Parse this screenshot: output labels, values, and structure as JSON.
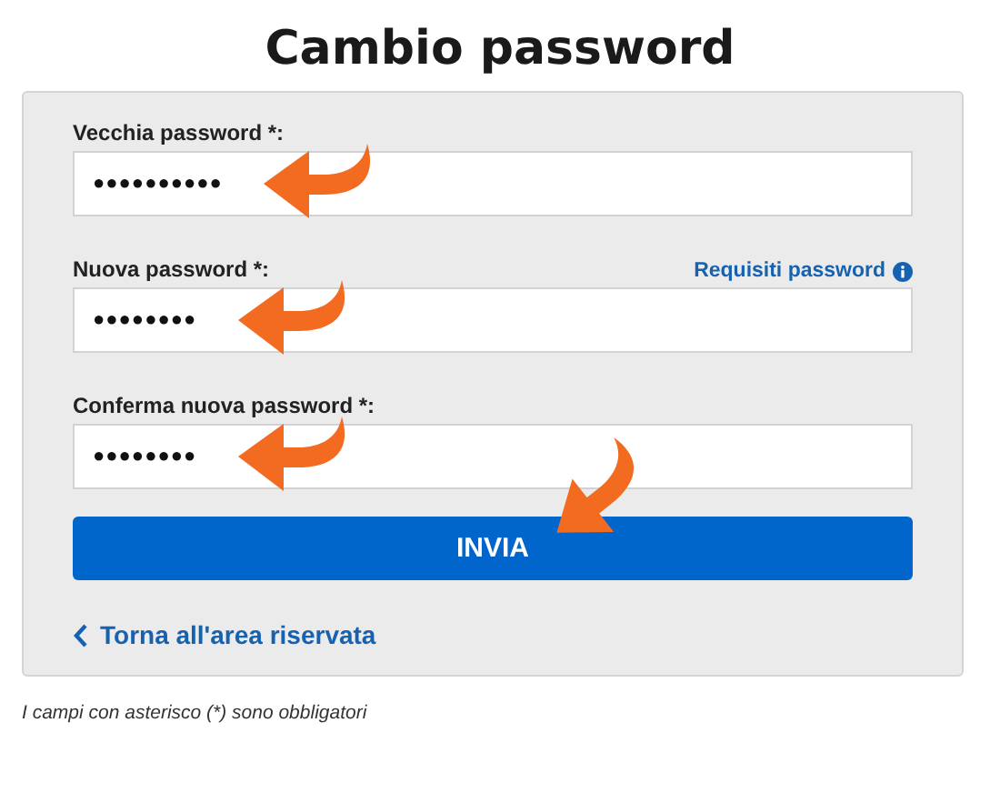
{
  "title": "Cambio password",
  "fields": [
    {
      "label": "Vecchia password *:",
      "value": "●●●●●●●●●●",
      "annotated": true
    },
    {
      "label": "Nuova password *:",
      "value": "●●●●●●●●",
      "annotated": true,
      "help_link": "Requisiti password"
    },
    {
      "label": "Conferma nuova password *:",
      "value": "●●●●●●●●",
      "annotated": true
    }
  ],
  "submit": {
    "label": "INVIA",
    "annotated": true
  },
  "back_link": "Torna all'area riservata",
  "footnote": "I campi con asterisco (*) sono obbligatori"
}
